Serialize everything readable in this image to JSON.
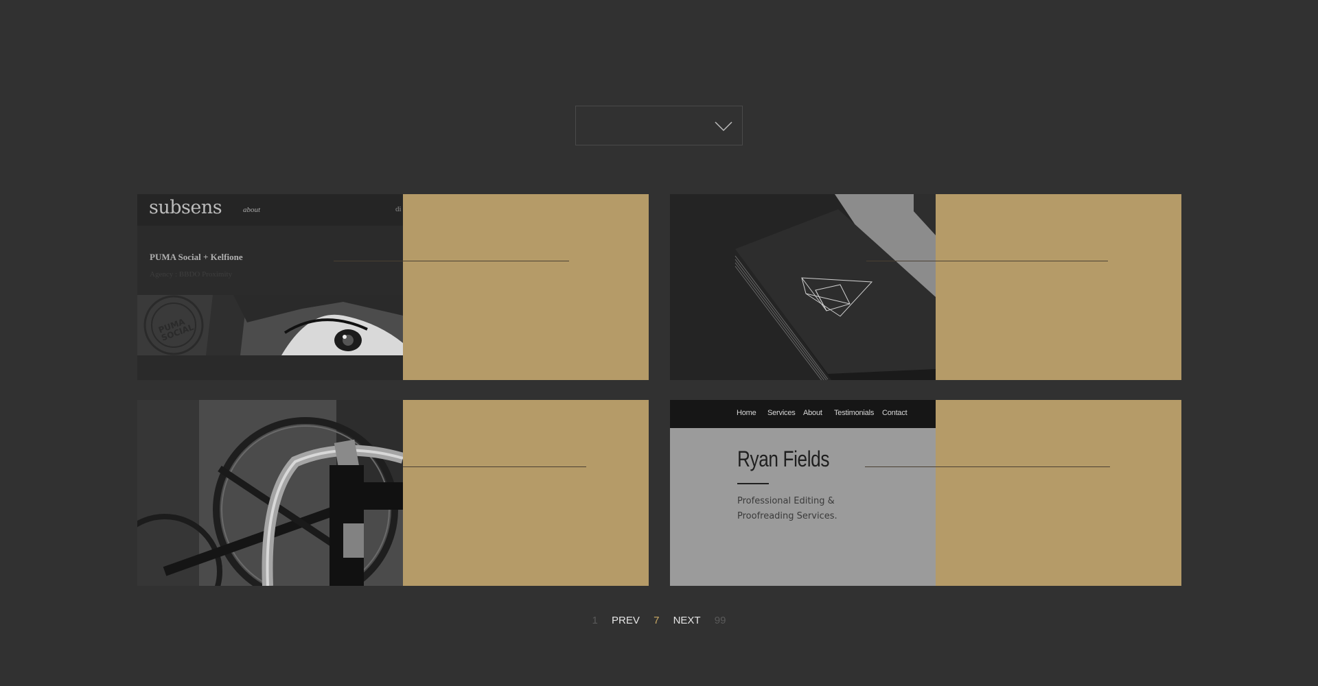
{
  "filter": {
    "selected": "",
    "icon": "chevron-down-icon"
  },
  "cards": [
    {
      "thumb": {
        "logo": "subsens",
        "nav_about": "about",
        "nav_cut": "di",
        "project": "PUMA Social + Kelfione",
        "agency": "Agency : BBDO Proximity"
      }
    },
    {
      "thumb": {}
    },
    {
      "thumb": {}
    },
    {
      "thumb": {
        "nav": [
          "Home",
          "Services",
          "About",
          "Testimonials",
          "Contact"
        ],
        "name": "Ryan Fields",
        "tagline_1": "Professional Editing &",
        "tagline_2": "Proofreading Services."
      }
    }
  ],
  "pagination": {
    "first": "1",
    "prev": "PREV",
    "current": "7",
    "next": "NEXT",
    "last": "99"
  },
  "colors": {
    "background": "#313131",
    "panel": "#b59b68",
    "accent": "#c8a864"
  }
}
